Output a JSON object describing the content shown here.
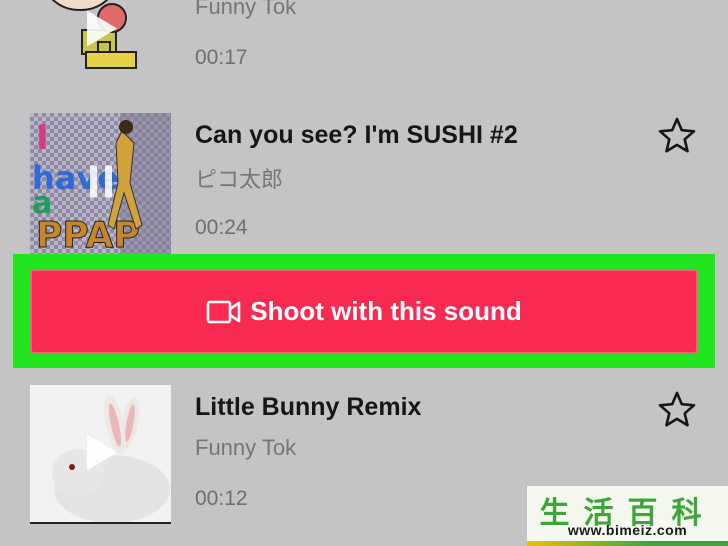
{
  "tracks": [
    {
      "title": "",
      "artist": "Funny Tok",
      "duration": "00:17"
    },
    {
      "title": "Can you see? I'm SUSHI #2",
      "artist": "ピコ太郎",
      "duration": "00:24",
      "cover_text": "I have a PPAP"
    },
    {
      "title": "Little Bunny Remix",
      "artist": "Funny Tok",
      "duration": "00:12"
    }
  ],
  "shoot_button": {
    "label": "Shoot with this sound",
    "icon": "video-camera-icon"
  },
  "watermark": {
    "chars": "生活百科",
    "url": "www.bimeiz.com"
  },
  "colors": {
    "accent": "#f82a51",
    "highlight": "#21e51f",
    "background": "#c4c4c4"
  }
}
